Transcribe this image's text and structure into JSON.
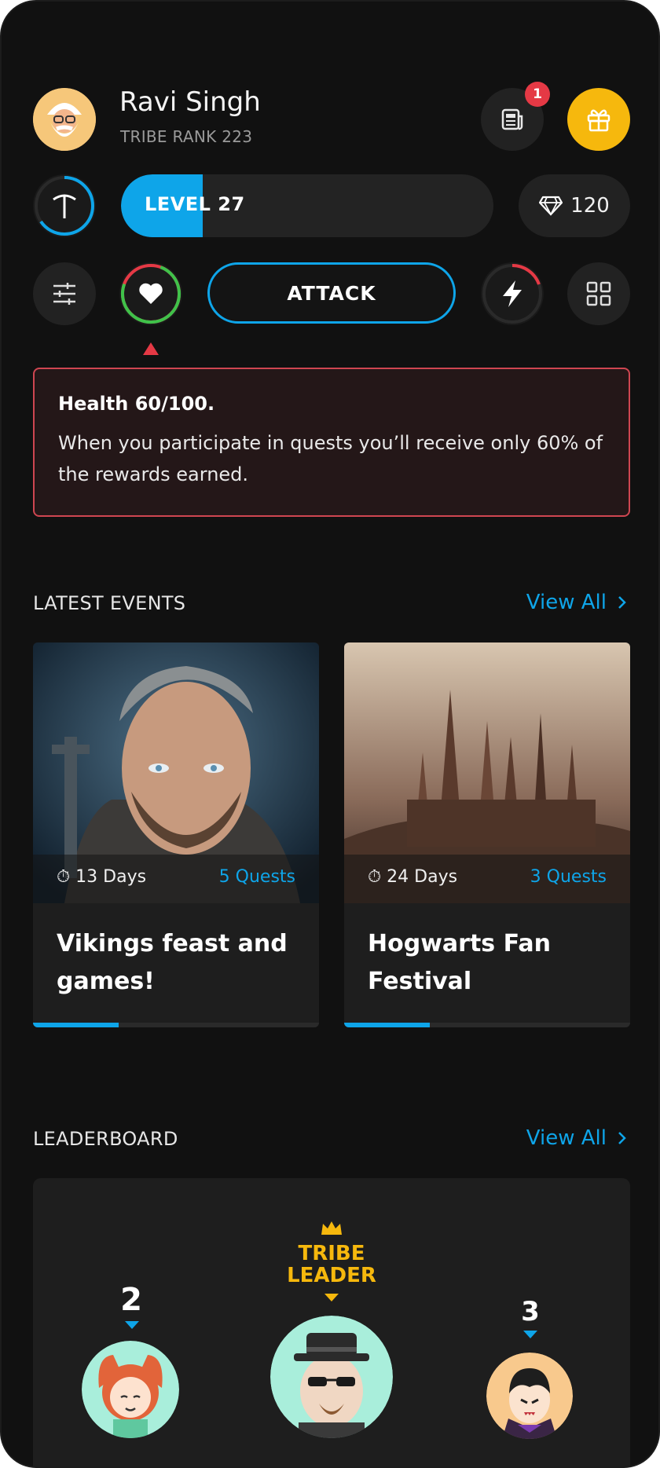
{
  "user": {
    "name": "Ravi Singh",
    "rank_label": "TRIBE RANK 223",
    "avatar_icon": "santa-avatar-icon"
  },
  "header": {
    "news_icon": "newspaper-icon",
    "news_badge_count": "1",
    "gift_icon": "gift-icon"
  },
  "stats": {
    "tool_icon": "pickaxe-icon",
    "level_label": "LEVEL 27",
    "level_progress": 0.22,
    "gems_value": "120",
    "gem_icon": "diamond-icon"
  },
  "actions": {
    "attack_label": "ATTACK",
    "health_progress": 0.6,
    "energy_progress": 0.2
  },
  "health_notice": {
    "title": "Health 60/100.",
    "body": "When you participate in quests you’ll receive only 60% of the rewards earned."
  },
  "events": {
    "title": "LATEST EVENTS",
    "view_all": "View All",
    "items": [
      {
        "days": "13 Days",
        "quests": "5 Quests",
        "title": "Vikings feast and games!",
        "progress": 0.3
      },
      {
        "days": "24 Days",
        "quests": "3 Quests",
        "title": "Hogwarts Fan Festival",
        "progress": 0.3
      }
    ]
  },
  "leaderboard": {
    "title": "LEADERBOARD",
    "view_all": "View All",
    "leader_label_line1": "TRIBE",
    "leader_label_line2": "LEADER",
    "second_rank": "2",
    "third_rank": "3"
  },
  "colors": {
    "accent": "#0ea5e9",
    "gold": "#f6b80d",
    "danger": "#e53945",
    "health_green": "#3fc24a",
    "background": "#111111"
  }
}
